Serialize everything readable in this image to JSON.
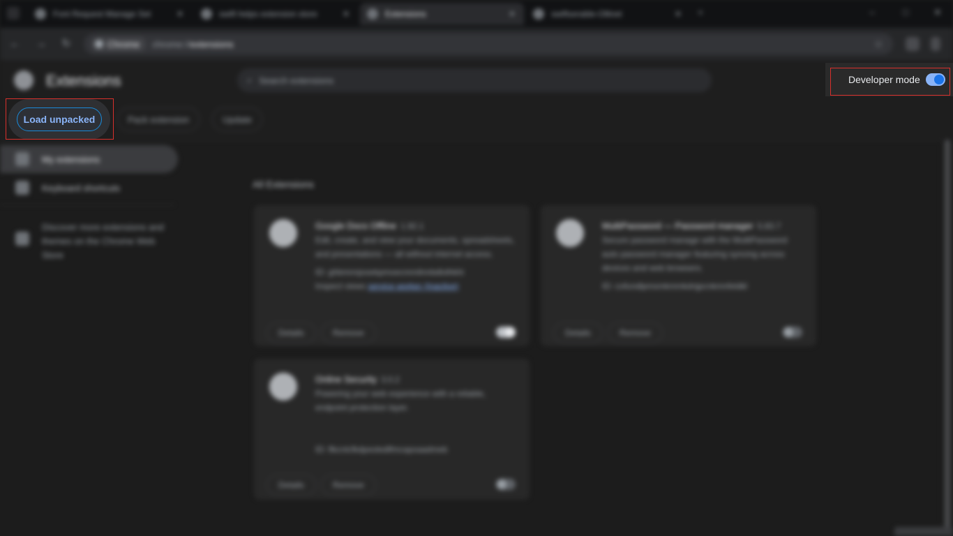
{
  "browser": {
    "tabs": [
      {
        "title": "Font Request Manage Set",
        "active": false
      },
      {
        "title": "swift helps extension store",
        "active": false
      },
      {
        "title": "Extensions",
        "active": true
      },
      {
        "title": "swiftserable-Ollinet",
        "active": false
      }
    ],
    "address": {
      "chip_label": "Chrome",
      "url_prefix": "chrome://",
      "url_path": "extensions"
    }
  },
  "header": {
    "title": "Extensions",
    "search_placeholder": "Search extensions",
    "developer_mode": {
      "label": "Developer mode",
      "enabled": true
    }
  },
  "dev_toolbar": {
    "load_unpacked": "Load unpacked",
    "pack_extension": "Pack extension",
    "update": "Update"
  },
  "sidebar": {
    "items": [
      {
        "label": "My extensions",
        "active": true
      },
      {
        "label": "Keyboard shortcuts",
        "active": false
      }
    ],
    "store_text": "Discover more extensions and themes on the Chrome Web Store"
  },
  "main": {
    "section_title": "All Extensions",
    "cards": [
      {
        "name": "Google Docs Offline",
        "version": "1.92.1",
        "description": "Edit, create, and view your documents, spreadsheets, and presentations — all without internet access.",
        "id_line": "ID: ghbmnnjooekpmoecnnnilnnbdlolhkhi",
        "inspect_label": "Inspect views",
        "inspect_link": "service worker (Inactive)",
        "enabled": true
      },
      {
        "name": "MultiPassword — Password manager",
        "version": "5.83.7",
        "description": "Secure password manage with the MultiPassword auto password manager featuring syncing across devices and web browsers.",
        "id_line": "ID: cofundlpmsmkmmkdnjpcnkmnfeldkl",
        "inspect_label": "",
        "inspect_link": "",
        "enabled": false
      },
      {
        "name": "Online Security",
        "version": "3.0.2",
        "description": "Powering your web experience with a reliable, endpoint protection layer.",
        "id_line": "ID: flkcnlcfkdpeoledlfmcapoaadmeb",
        "inspect_label": "",
        "inspect_link": "",
        "enabled": false
      }
    ],
    "details_label": "Details",
    "remove_label": "Remove"
  }
}
